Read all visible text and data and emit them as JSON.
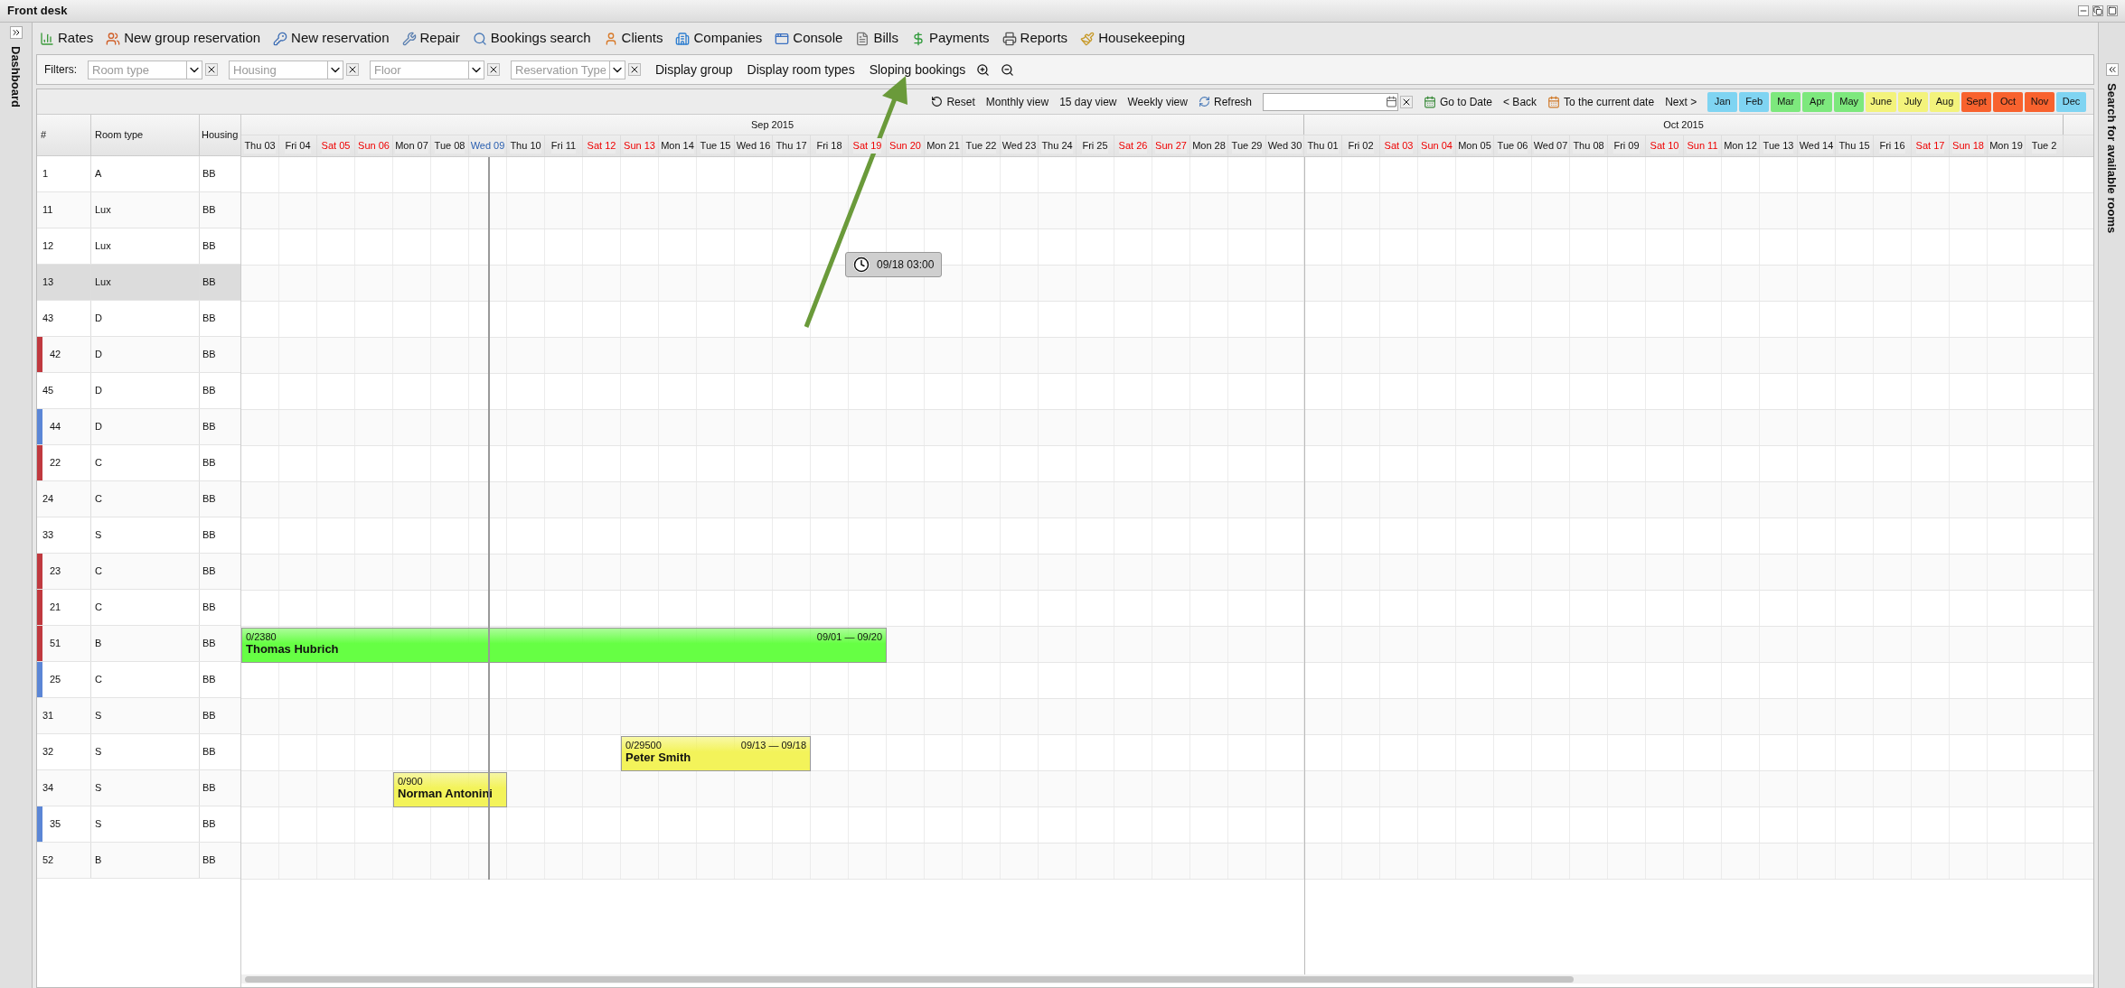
{
  "window": {
    "title": "Front desk"
  },
  "toolbar": [
    {
      "label": "Rates"
    },
    {
      "label": "New group reservation"
    },
    {
      "label": "New reservation"
    },
    {
      "label": "Repair"
    },
    {
      "label": "Bookings search"
    },
    {
      "label": "Clients"
    },
    {
      "label": "Companies"
    },
    {
      "label": "Console"
    },
    {
      "label": "Bills"
    },
    {
      "label": "Payments"
    },
    {
      "label": "Reports"
    },
    {
      "label": "Housekeeping"
    }
  ],
  "left_panel": {
    "label": "Dashboard"
  },
  "right_panel": {
    "label": "Search for available rooms"
  },
  "filters": {
    "label": "Filters:",
    "fields": [
      {
        "placeholder": "Room type"
      },
      {
        "placeholder": "Housing"
      },
      {
        "placeholder": "Floor"
      },
      {
        "placeholder": "Reservation Type"
      }
    ],
    "links": [
      "Display group",
      "Display room types",
      "Sloping bookings"
    ]
  },
  "nav": {
    "reset": "Reset",
    "views": [
      "Monthly view",
      "15 day view",
      "Weekly view"
    ],
    "refresh": "Refresh",
    "go_to_date": "Go to Date",
    "back": "< Back",
    "current": "To the current date",
    "next": "Next >",
    "months": [
      {
        "label": "Jan",
        "color": "#7fd4f2"
      },
      {
        "label": "Feb",
        "color": "#7fd4f2"
      },
      {
        "label": "Mar",
        "color": "#7de87d"
      },
      {
        "label": "Apr",
        "color": "#7de87d"
      },
      {
        "label": "May",
        "color": "#7de87d"
      },
      {
        "label": "June",
        "color": "#f3f37c"
      },
      {
        "label": "July",
        "color": "#f3f37c"
      },
      {
        "label": "Aug",
        "color": "#f3f37c"
      },
      {
        "label": "Sept",
        "color": "#f8622e"
      },
      {
        "label": "Oct",
        "color": "#f8622e"
      },
      {
        "label": "Nov",
        "color": "#f8622e"
      },
      {
        "label": "Dec",
        "color": "#7fd4f2"
      }
    ]
  },
  "table": {
    "columns": [
      "#",
      "Room type",
      "Housing"
    ],
    "rows": [
      {
        "number": "1",
        "type": "A",
        "housing": "BB",
        "selected": false
      },
      {
        "number": "11",
        "type": "Lux",
        "housing": "BB",
        "selected": false
      },
      {
        "number": "12",
        "type": "Lux",
        "housing": "BB",
        "selected": false
      },
      {
        "number": "13",
        "type": "Lux",
        "housing": "BB",
        "selected": true
      },
      {
        "number": "43",
        "type": "D",
        "housing": "BB",
        "selected": false
      },
      {
        "number": "42",
        "type": "D",
        "housing": "BB",
        "selected": false,
        "color": "#c0393f"
      },
      {
        "number": "45",
        "type": "D",
        "housing": "BB",
        "selected": false
      },
      {
        "number": "44",
        "type": "D",
        "housing": "BB",
        "selected": false,
        "color": "#5b86d6"
      },
      {
        "number": "22",
        "type": "C",
        "housing": "BB",
        "selected": false,
        "color": "#c0393f"
      },
      {
        "number": "24",
        "type": "C",
        "housing": "BB",
        "selected": false
      },
      {
        "number": "33",
        "type": "S",
        "housing": "BB",
        "selected": false
      },
      {
        "number": "23",
        "type": "C",
        "housing": "BB",
        "selected": false,
        "color": "#c0393f"
      },
      {
        "number": "21",
        "type": "C",
        "housing": "BB",
        "selected": false,
        "color": "#c0393f"
      },
      {
        "number": "51",
        "type": "B",
        "housing": "BB",
        "selected": false,
        "color": "#c0393f"
      },
      {
        "number": "25",
        "type": "C",
        "housing": "BB",
        "selected": false,
        "color": "#5b86d6"
      },
      {
        "number": "31",
        "type": "S",
        "housing": "BB",
        "selected": false
      },
      {
        "number": "32",
        "type": "S",
        "housing": "BB",
        "selected": false
      },
      {
        "number": "34",
        "type": "S",
        "housing": "BB",
        "selected": false
      },
      {
        "number": "35",
        "type": "S",
        "housing": "BB",
        "selected": false,
        "color": "#5b86d6"
      },
      {
        "number": "52",
        "type": "B",
        "housing": "BB",
        "selected": false
      }
    ]
  },
  "calendar": {
    "months": [
      {
        "label": "Sep 2015",
        "days": [
          {
            "label": "Thu 03",
            "weekend": false,
            "today": false
          },
          {
            "label": "Fri 04",
            "weekend": false,
            "today": false
          },
          {
            "label": "Sat 05",
            "weekend": true,
            "today": false
          },
          {
            "label": "Sun 06",
            "weekend": true,
            "today": false
          },
          {
            "label": "Mon 07",
            "weekend": false,
            "today": false
          },
          {
            "label": "Tue 08",
            "weekend": false,
            "today": false
          },
          {
            "label": "Wed 09",
            "weekend": false,
            "today": true
          },
          {
            "label": "Thu 10",
            "weekend": false,
            "today": false
          },
          {
            "label": "Fri 11",
            "weekend": false,
            "today": false
          },
          {
            "label": "Sat 12",
            "weekend": true,
            "today": false
          },
          {
            "label": "Sun 13",
            "weekend": true,
            "today": false
          },
          {
            "label": "Mon 14",
            "weekend": false,
            "today": false
          },
          {
            "label": "Tue 15",
            "weekend": false,
            "today": false
          },
          {
            "label": "Wed 16",
            "weekend": false,
            "today": false
          },
          {
            "label": "Thu 17",
            "weekend": false,
            "today": false
          },
          {
            "label": "Fri 18",
            "weekend": false,
            "today": false
          },
          {
            "label": "Sat 19",
            "weekend": true,
            "today": false
          },
          {
            "label": "Sun 20",
            "weekend": true,
            "today": false
          },
          {
            "label": "Mon 21",
            "weekend": false,
            "today": false
          },
          {
            "label": "Tue 22",
            "weekend": false,
            "today": false
          },
          {
            "label": "Wed 23",
            "weekend": false,
            "today": false
          },
          {
            "label": "Thu 24",
            "weekend": false,
            "today": false
          },
          {
            "label": "Fri 25",
            "weekend": false,
            "today": false
          },
          {
            "label": "Sat 26",
            "weekend": true,
            "today": false
          },
          {
            "label": "Sun 27",
            "weekend": true,
            "today": false
          },
          {
            "label": "Mon 28",
            "weekend": false,
            "today": false
          },
          {
            "label": "Tue 29",
            "weekend": false,
            "today": false
          },
          {
            "label": "Wed 30",
            "weekend": false,
            "today": false
          }
        ]
      },
      {
        "label": "Oct 2015",
        "days": [
          {
            "label": "Thu 01",
            "weekend": false,
            "today": false
          },
          {
            "label": "Fri 02",
            "weekend": false,
            "today": false
          },
          {
            "label": "Sat 03",
            "weekend": true,
            "today": false
          },
          {
            "label": "Sun 04",
            "weekend": true,
            "today": false
          },
          {
            "label": "Mon 05",
            "weekend": false,
            "today": false
          },
          {
            "label": "Tue 06",
            "weekend": false,
            "today": false
          },
          {
            "label": "Wed 07",
            "weekend": false,
            "today": false
          },
          {
            "label": "Thu 08",
            "weekend": false,
            "today": false
          },
          {
            "label": "Fri 09",
            "weekend": false,
            "today": false
          },
          {
            "label": "Sat 10",
            "weekend": true,
            "today": false
          },
          {
            "label": "Sun 11",
            "weekend": true,
            "today": false
          },
          {
            "label": "Mon 12",
            "weekend": false,
            "today": false
          },
          {
            "label": "Tue 13",
            "weekend": false,
            "today": false
          },
          {
            "label": "Wed 14",
            "weekend": false,
            "today": false
          },
          {
            "label": "Thu 15",
            "weekend": false,
            "today": false
          },
          {
            "label": "Fri 16",
            "weekend": false,
            "today": false
          },
          {
            "label": "Sat 17",
            "weekend": true,
            "today": false
          },
          {
            "label": "Sun 18",
            "weekend": true,
            "today": false
          },
          {
            "label": "Mon 19",
            "weekend": false,
            "today": false
          },
          {
            "label": "Tue 2",
            "weekend": false,
            "today": false
          }
        ]
      }
    ],
    "bookings": [
      {
        "amount": "0/2380",
        "guest": "Thomas Hubrich",
        "dates": "09/01 — 09/20",
        "color": "#66ff44"
      },
      {
        "amount": "0/29500",
        "guest": "Peter Smith",
        "dates": "09/13 — 09/18",
        "color": "#f3f35a"
      },
      {
        "amount": "0/900",
        "guest": "Norman Antonini",
        "color": "#f3f35a"
      }
    ],
    "tooltip": "09/18 03:00"
  }
}
